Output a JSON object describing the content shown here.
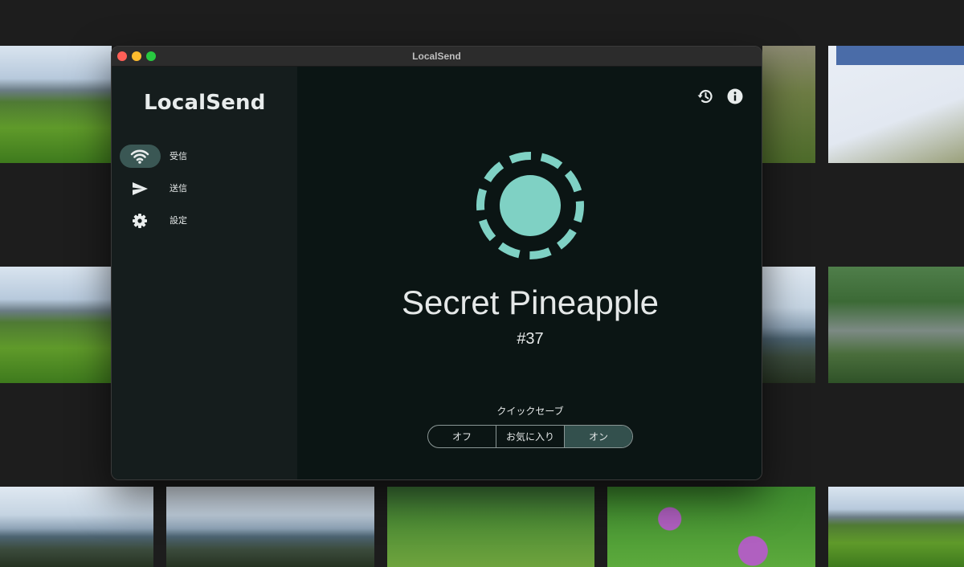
{
  "window": {
    "title": "LocalSend"
  },
  "sidebar": {
    "app_name": "LocalSend",
    "items": [
      {
        "label": "受信",
        "icon": "wifi-icon",
        "active": true
      },
      {
        "label": "送信",
        "icon": "send-icon",
        "active": false
      },
      {
        "label": "設定",
        "icon": "gear-icon",
        "active": false
      }
    ]
  },
  "main": {
    "top_actions": [
      {
        "icon": "history-icon"
      },
      {
        "icon": "info-icon"
      }
    ],
    "device_name": "Secret Pineapple",
    "device_id": "#37",
    "quick_save": {
      "label": "クイックセーブ",
      "options": [
        "オフ",
        "お気に入り",
        "オン"
      ],
      "selected": "オン"
    }
  },
  "colors": {
    "accent": "#7fd1c4",
    "sidebar_bg": "#151d1d",
    "main_bg": "#0b1514",
    "active_pill": "#3a5754"
  }
}
